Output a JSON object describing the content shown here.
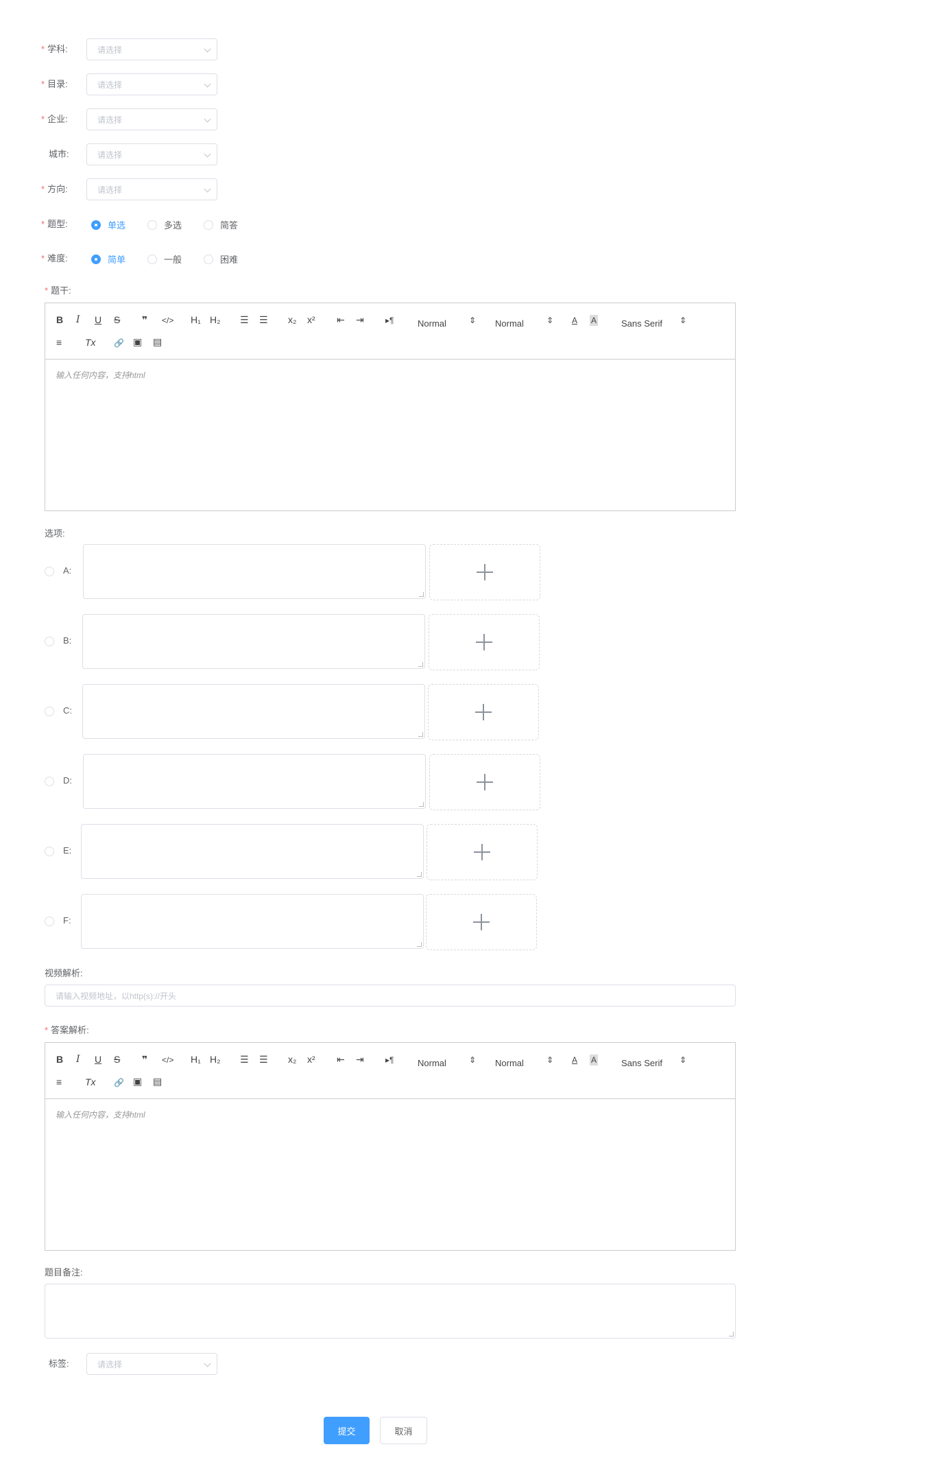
{
  "form": {
    "subject": {
      "label": "学科:",
      "placeholder": "请选择"
    },
    "catalog": {
      "label": "目录:",
      "placeholder": "请选择"
    },
    "company": {
      "label": "企业:",
      "placeholder": "请选择"
    },
    "city": {
      "label": "城市:",
      "placeholder": "请选择"
    },
    "direction": {
      "label": "方向:",
      "placeholder": "请选择"
    },
    "question_type": {
      "label": "题型:",
      "options": [
        "单选",
        "多选",
        "简答"
      ],
      "selected": "单选"
    },
    "difficulty": {
      "label": "难度:",
      "options": [
        "简单",
        "一般",
        "困难"
      ],
      "selected": "简单"
    },
    "stem": {
      "label": "题干:",
      "placeholder": "输入任何内容，支持html"
    },
    "options_label": "选项:",
    "options": [
      "A:",
      "B:",
      "C:",
      "D:",
      "E:",
      "F:"
    ],
    "video": {
      "label": "视频解析:",
      "placeholder": "请输入视频地址，以http(s)://开头"
    },
    "answer": {
      "label": "答案解析:",
      "placeholder": "输入任何内容，支持html"
    },
    "remark": {
      "label": "题目备注:"
    },
    "tags": {
      "label": "标签:",
      "placeholder": "请选择"
    },
    "submit": "提交",
    "cancel": "取消"
  },
  "toolbar": {
    "bold": "B",
    "italic": "I",
    "underline": "U",
    "strike": "S",
    "quote": "❞",
    "code": "</>",
    "h1": "H₁",
    "h2": "H₂",
    "ordered_list": "☰",
    "bullet_list": "☰",
    "subscript": "x₂",
    "superscript": "x²",
    "outdent": "⇤",
    "indent": "⇥",
    "direction": "▸¶",
    "size": "Normal",
    "header": "Normal",
    "color": "A",
    "background": "A",
    "font": "Sans Serif",
    "align": "≡",
    "clean": "Tx",
    "link": "🔗",
    "image": "▣",
    "video": "▤"
  },
  "colors": {
    "primary": "#409eff",
    "required": "#f56c6c"
  }
}
